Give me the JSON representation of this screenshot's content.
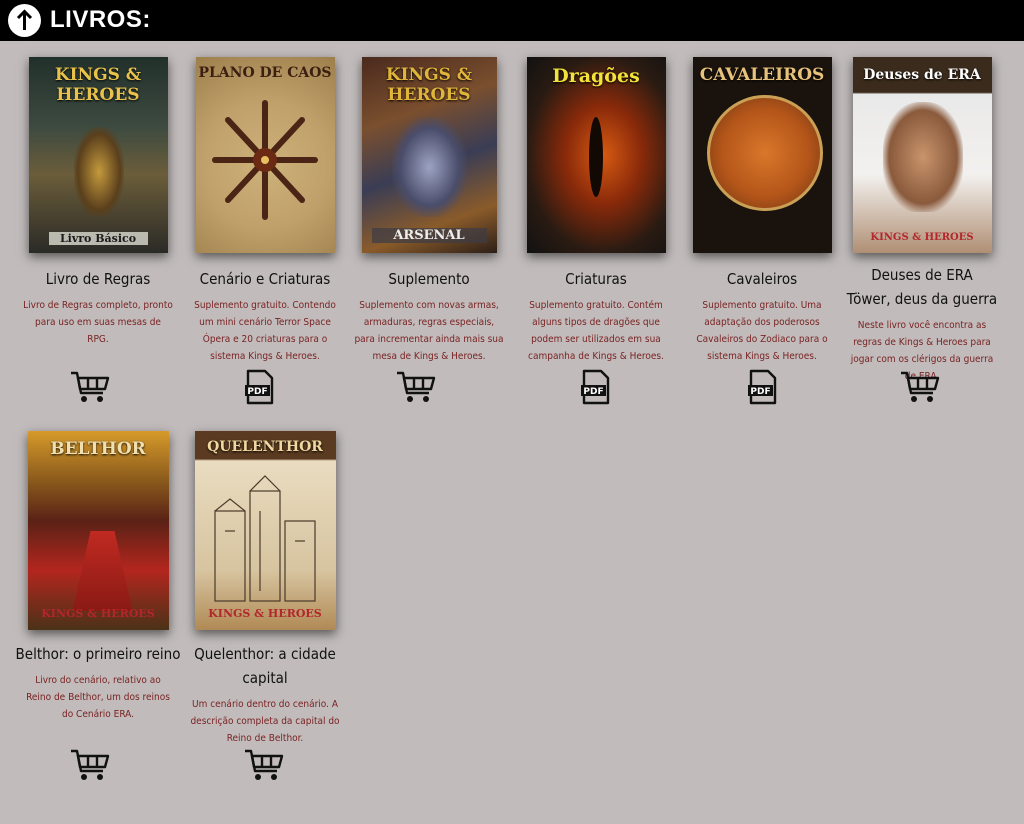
{
  "header": {
    "title": "LIVROS:"
  },
  "books": [
    {
      "name": "Livro de Regras",
      "desc": "Livro de Regras completo, pronto para uso em suas mesas de RPG.",
      "cover_title": "KINGS & HEROES",
      "cover_sub": "Livro Básico",
      "action": "cart-icon"
    },
    {
      "name": "Cenário e Criaturas",
      "desc": "Suplemento gratuito. Contendo um mini cenário Terror Space Ópera e 20 criaturas para o sistema Kings & Heroes.",
      "cover_title": "PLANO DE CAOS",
      "cover_sub": "",
      "action": "pdf-icon"
    },
    {
      "name": "Suplemento",
      "desc": "Suplemento com novas armas, armaduras, regras especiais, para incrementar ainda mais sua mesa de Kings & Heroes.",
      "cover_title": "KINGS & HEROES",
      "cover_sub": "ARSENAL",
      "action": "cart-icon"
    },
    {
      "name": "Criaturas",
      "desc": "Suplemento gratuito. Contém alguns tipos de dragões que podem ser utilizados em sua campanha de Kings & Heroes.",
      "cover_title": "Dragões",
      "cover_sub": "",
      "action": "pdf-icon"
    },
    {
      "name": "Cavaleiros",
      "desc": "Suplemento gratuito. Uma adaptação dos poderosos Cavaleiros do Zodiaco para o sistema Kings & Heroes.",
      "cover_title": "CAVALEIROS",
      "cover_sub": "",
      "action": "pdf-icon"
    },
    {
      "name": "Deuses de ERA\nTöwer, deus da guerra",
      "desc": "Neste livro você encontra as regras de Kings & Heroes para jogar com os clérigos da guerra de ERA.",
      "cover_title": "Deuses de ERA",
      "cover_sub": "KINGS & HEROES",
      "action": "cart-icon"
    },
    {
      "name": "Belthor: o primeiro reino",
      "desc": "Livro do cenário, relativo ao Reino de Belthor, um dos reinos do Cenário ERA.",
      "cover_title": "BELTHOR",
      "cover_sub": "KINGS & HEROES",
      "action": "cart-icon"
    },
    {
      "name": "Quelenthor: a cidade capital",
      "desc": "Um cenário dentro do cenário. A descrição completa da capital do Reino de Belthor.",
      "cover_title": "QUELENTHOR",
      "cover_sub": "KINGS & HEROES",
      "action": "cart-icon"
    }
  ]
}
